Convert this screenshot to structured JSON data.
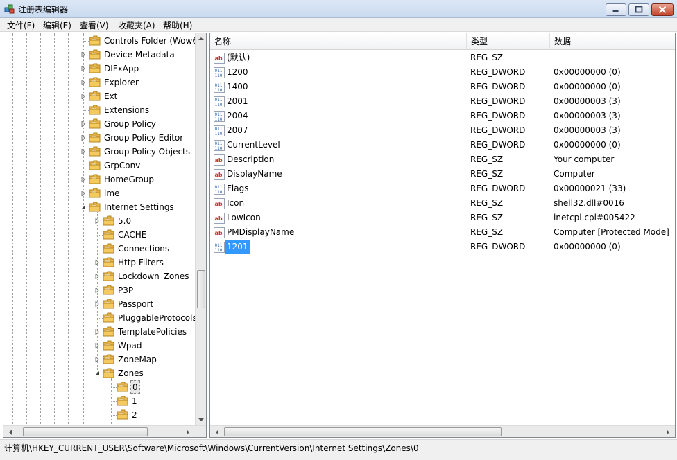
{
  "window": {
    "title": "注册表编辑器",
    "icon": "registry-editor-icon"
  },
  "menu": [
    {
      "label": "文件(F)"
    },
    {
      "label": "编辑(E)"
    },
    {
      "label": "查看(V)"
    },
    {
      "label": "收藏夹(A)"
    },
    {
      "label": "帮助(H)"
    }
  ],
  "tree": {
    "items": [
      {
        "label": "Controls Folder (Wow6",
        "expander": "none"
      },
      {
        "label": "Device Metadata",
        "expander": "collapsed"
      },
      {
        "label": "DIFxApp",
        "expander": "collapsed"
      },
      {
        "label": "Explorer",
        "expander": "collapsed"
      },
      {
        "label": "Ext",
        "expander": "collapsed"
      },
      {
        "label": "Extensions",
        "expander": "none"
      },
      {
        "label": "Group Policy",
        "expander": "collapsed"
      },
      {
        "label": "Group Policy Editor",
        "expander": "collapsed"
      },
      {
        "label": "Group Policy Objects",
        "expander": "collapsed"
      },
      {
        "label": "GrpConv",
        "expander": "none"
      },
      {
        "label": "HomeGroup",
        "expander": "collapsed"
      },
      {
        "label": "ime",
        "expander": "collapsed"
      },
      {
        "label": "Internet Settings",
        "expander": "expanded"
      },
      {
        "label": "5.0",
        "expander": "collapsed"
      },
      {
        "label": "CACHE",
        "expander": "none"
      },
      {
        "label": "Connections",
        "expander": "none"
      },
      {
        "label": "Http Filters",
        "expander": "collapsed"
      },
      {
        "label": "Lockdown_Zones",
        "expander": "collapsed"
      },
      {
        "label": "P3P",
        "expander": "collapsed"
      },
      {
        "label": "Passport",
        "expander": "collapsed"
      },
      {
        "label": "PluggableProtocols",
        "expander": "none"
      },
      {
        "label": "TemplatePolicies",
        "expander": "collapsed"
      },
      {
        "label": "Wpad",
        "expander": "collapsed"
      },
      {
        "label": "ZoneMap",
        "expander": "collapsed"
      },
      {
        "label": "Zones",
        "expander": "expanded"
      },
      {
        "label": "0",
        "expander": "none"
      },
      {
        "label": "1",
        "expander": "none"
      },
      {
        "label": "2",
        "expander": "none"
      }
    ]
  },
  "list": {
    "columns": [
      {
        "label": "名称"
      },
      {
        "label": "类型"
      },
      {
        "label": "数据"
      }
    ],
    "rows": [
      {
        "icon": "string",
        "name": "(默认)",
        "type": "REG_SZ",
        "data": ""
      },
      {
        "icon": "binary",
        "name": "1200",
        "type": "REG_DWORD",
        "data": "0x00000000 (0)"
      },
      {
        "icon": "binary",
        "name": "1400",
        "type": "REG_DWORD",
        "data": "0x00000000 (0)"
      },
      {
        "icon": "binary",
        "name": "2001",
        "type": "REG_DWORD",
        "data": "0x00000003 (3)"
      },
      {
        "icon": "binary",
        "name": "2004",
        "type": "REG_DWORD",
        "data": "0x00000003 (3)"
      },
      {
        "icon": "binary",
        "name": "2007",
        "type": "REG_DWORD",
        "data": "0x00000003 (3)"
      },
      {
        "icon": "binary",
        "name": "CurrentLevel",
        "type": "REG_DWORD",
        "data": "0x00000000 (0)"
      },
      {
        "icon": "string",
        "name": "Description",
        "type": "REG_SZ",
        "data": "Your computer"
      },
      {
        "icon": "string",
        "name": "DisplayName",
        "type": "REG_SZ",
        "data": "Computer"
      },
      {
        "icon": "binary",
        "name": "Flags",
        "type": "REG_DWORD",
        "data": "0x00000021 (33)"
      },
      {
        "icon": "string",
        "name": "Icon",
        "type": "REG_SZ",
        "data": "shell32.dll#0016"
      },
      {
        "icon": "string",
        "name": "LowIcon",
        "type": "REG_SZ",
        "data": "inetcpl.cpl#005422"
      },
      {
        "icon": "string",
        "name": "PMDisplayName",
        "type": "REG_SZ",
        "data": "Computer [Protected Mode]"
      },
      {
        "icon": "binary",
        "name": "1201",
        "type": "REG_DWORD",
        "data": "0x00000000 (0)"
      }
    ]
  },
  "status": {
    "path": "计算机\\HKEY_CURRENT_USER\\Software\\Microsoft\\Windows\\CurrentVersion\\Internet Settings\\Zones\\0"
  },
  "colors": {
    "selection": "#3399ff",
    "folder": "#e8b54a"
  }
}
